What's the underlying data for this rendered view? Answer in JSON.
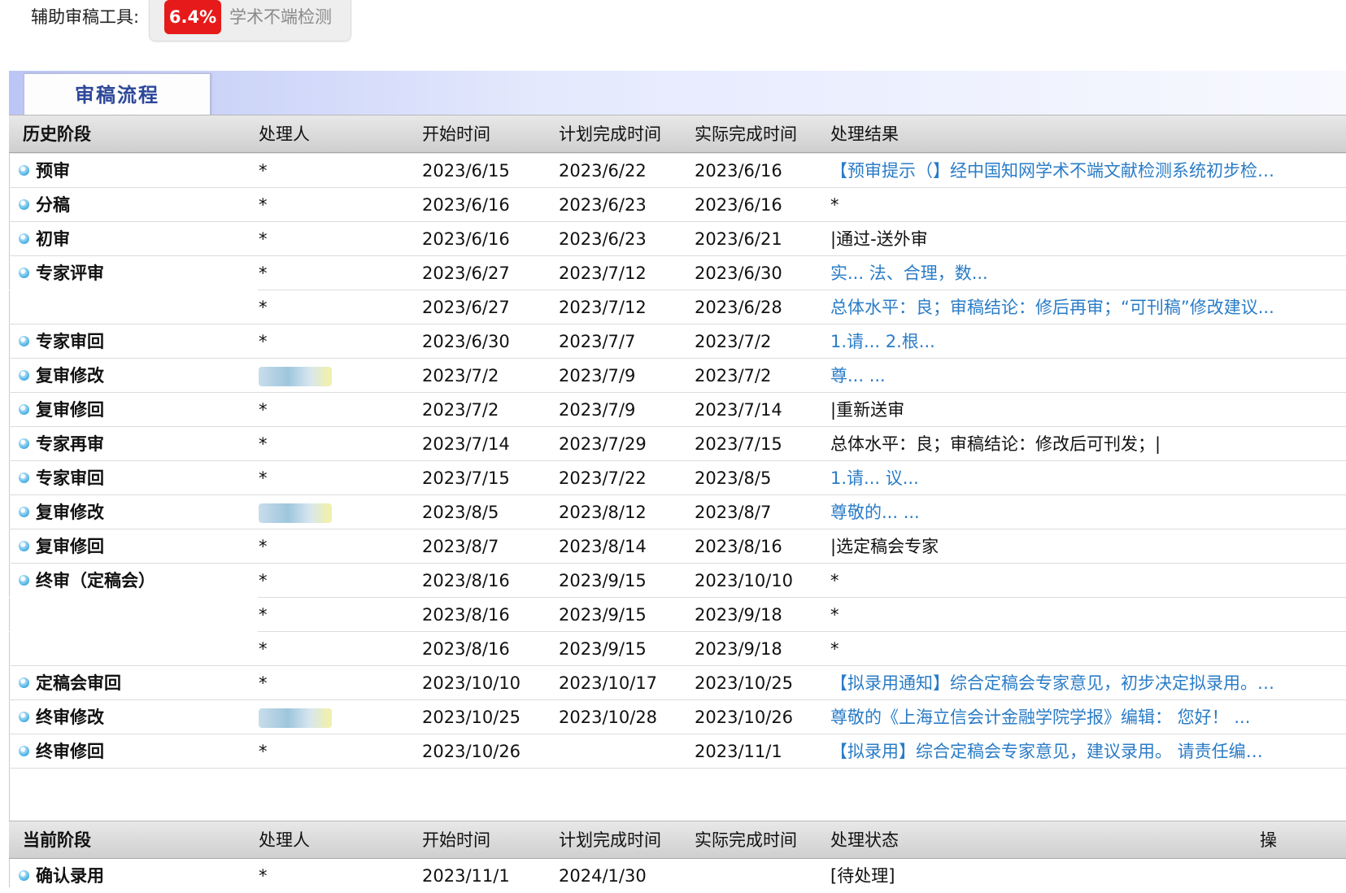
{
  "toolbar": {
    "label": "辅助审稿工具:",
    "rate": "6.4%",
    "tool_name": "学术不端检测"
  },
  "tab": {
    "label": "审稿流程"
  },
  "history": {
    "headers": [
      "历史阶段",
      "处理人",
      "开始时间",
      "计划完成时间",
      "实际完成时间",
      "处理结果"
    ],
    "rows": [
      {
        "stage": "预审",
        "handler": "*",
        "start": "2023/6/15",
        "planned": "2023/6/22",
        "actual": "2023/6/16",
        "result": "【预审提示（】经中国知网学术不端文献检测系统初步检测...",
        "link": true
      },
      {
        "stage": "分稿",
        "handler": "*",
        "start": "2023/6/16",
        "planned": "2023/6/23",
        "actual": "2023/6/16",
        "result": "*",
        "link": false
      },
      {
        "stage": "初审",
        "handler": "*",
        "start": "2023/6/16",
        "planned": "2023/6/23",
        "actual": "2023/6/21",
        "result": "|通过-送外审",
        "link": false
      },
      {
        "stage": "专家评审",
        "handler": "*",
        "start": "2023/6/27",
        "planned": "2023/7/12",
        "actual": "2023/6/30",
        "result": "实... 法、合理，数...",
        "link": true
      },
      {
        "stage": "",
        "handler": "*",
        "start": "2023/6/27",
        "planned": "2023/7/12",
        "actual": "2023/6/28",
        "result": "总体水平：良；审稿结论：修后再审；“可刊稿”修改建议...",
        "link": true
      },
      {
        "stage": "专家审回",
        "handler": "*",
        "start": "2023/6/30",
        "planned": "2023/7/7",
        "actual": "2023/7/2",
        "result": "1.请... 2.根...",
        "link": true
      },
      {
        "stage": "复审修改",
        "handler": "",
        "start": "2023/7/2",
        "planned": "2023/7/9",
        "actual": "2023/7/2",
        "result": "尊... ...",
        "link": true
      },
      {
        "stage": "复审修回",
        "handler": "*",
        "start": "2023/7/2",
        "planned": "2023/7/9",
        "actual": "2023/7/14",
        "result": "|重新送审",
        "link": false
      },
      {
        "stage": "专家再审",
        "handler": "*",
        "start": "2023/7/14",
        "planned": "2023/7/29",
        "actual": "2023/7/15",
        "result": "总体水平：良；审稿结论：修改后可刊发；|",
        "link": false
      },
      {
        "stage": "专家审回",
        "handler": "*",
        "start": "2023/7/15",
        "planned": "2023/7/22",
        "actual": "2023/8/5",
        "result": "1.请... 议...",
        "link": true
      },
      {
        "stage": "复审修改",
        "handler": "",
        "start": "2023/8/5",
        "planned": "2023/8/12",
        "actual": "2023/8/7",
        "result": "尊敬的... ...",
        "link": true
      },
      {
        "stage": "复审修回",
        "handler": "*",
        "start": "2023/8/7",
        "planned": "2023/8/14",
        "actual": "2023/8/16",
        "result": "|选定稿会专家",
        "link": false
      },
      {
        "stage": "终审（定稿会）",
        "handler": "*",
        "start": "2023/8/16",
        "planned": "2023/9/15",
        "actual": "2023/10/10",
        "result": "*",
        "link": false
      },
      {
        "stage": "",
        "handler": "*",
        "start": "2023/8/16",
        "planned": "2023/9/15",
        "actual": "2023/9/18",
        "result": "*",
        "link": false
      },
      {
        "stage": "",
        "handler": "*",
        "start": "2023/8/16",
        "planned": "2023/9/15",
        "actual": "2023/9/18",
        "result": "*",
        "link": false
      },
      {
        "stage": "定稿会审回",
        "handler": "*",
        "start": "2023/10/10",
        "planned": "2023/10/17",
        "actual": "2023/10/25",
        "result": "【拟录用通知】综合定稿会专家意见，初步决定拟录用。请...",
        "link": true
      },
      {
        "stage": "终审修改",
        "handler": "",
        "start": "2023/10/25",
        "planned": "2023/10/28",
        "actual": "2023/10/26",
        "result": "尊敬的《上海立信会计金融学院学报》编辑：  您好！  ...",
        "link": true
      },
      {
        "stage": "终审修回",
        "handler": "*",
        "start": "2023/10/26",
        "planned": "",
        "actual": "2023/11/1",
        "result": "【拟录用】综合定稿会专家意见，建议录用。 请责任编辑...",
        "link": true
      }
    ]
  },
  "current": {
    "headers": [
      "当前阶段",
      "处理人",
      "开始时间",
      "计划完成时间",
      "实际完成时间",
      "处理状态",
      "操"
    ],
    "rows": [
      {
        "stage": "确认录用",
        "handler": "*",
        "start": "2023/11/1",
        "planned": "2024/1/30",
        "actual": "",
        "status": "[待处理]"
      }
    ]
  }
}
